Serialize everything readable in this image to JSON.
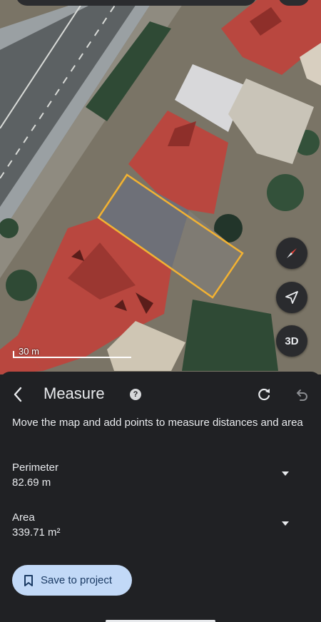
{
  "map": {
    "scale_label": "30 m",
    "three_d_label": "3D",
    "colors": {
      "road": "#5c6163",
      "roof_red": "#b9473f",
      "roof_gray": "#6e7078",
      "outline": "#f2b233",
      "vegetation": "#2f4a35"
    }
  },
  "sheet": {
    "title": "Measure",
    "help_icon": "?",
    "description": "Move the map and add points to measure distances and area",
    "perimeter": {
      "label": "Perimeter",
      "value": "82.69 m"
    },
    "area": {
      "label": "Area",
      "value": "339.71 m²"
    },
    "save_label": "Save to project",
    "icons": {
      "back": "back-icon",
      "help": "help-icon",
      "redo": "redo-icon",
      "undo": "undo-icon",
      "bookmark": "bookmark-icon",
      "compass": "compass-icon",
      "locate": "navigation-arrow-icon"
    },
    "accent": "#c2d9f7"
  }
}
